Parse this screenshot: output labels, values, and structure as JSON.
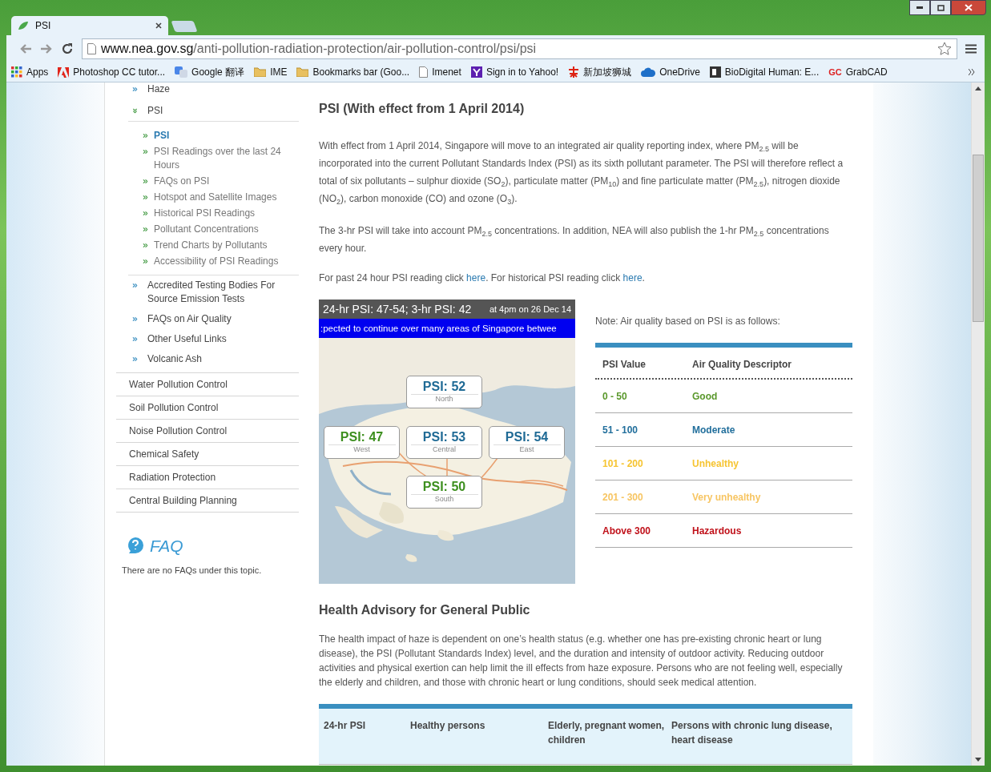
{
  "tabs": [
    {
      "label": "PSI",
      "selected": true
    }
  ],
  "address": {
    "host": "www.nea.gov.sg",
    "path": "/anti-pollution-radiation-protection/air-pollution-control/psi/psi"
  },
  "bookmarks": [
    {
      "label": "Apps",
      "kind": "apps"
    },
    {
      "label": "Photoshop CC tutor...",
      "kind": "adobe"
    },
    {
      "label": "Google 翻译",
      "kind": "translate"
    },
    {
      "label": "IME",
      "kind": "folder"
    },
    {
      "label": "Bookmarks bar (Goo...",
      "kind": "folder"
    },
    {
      "label": "Imenet",
      "kind": "page"
    },
    {
      "label": "Sign in to Yahoo!",
      "kind": "yahoo"
    },
    {
      "label": "新加坡狮城",
      "kind": "emblem"
    },
    {
      "label": "OneDrive",
      "kind": "cloud"
    },
    {
      "label": "BioDigital Human: E...",
      "kind": "square"
    },
    {
      "label": "GrabCAD",
      "kind": "mark",
      "mark": "GC"
    }
  ],
  "sidebar": {
    "subitems": [
      {
        "label": "Haze",
        "expanded": false
      },
      {
        "label": "PSI",
        "expanded": true,
        "children": [
          {
            "label": "PSI",
            "selected": true
          },
          {
            "label": "PSI Readings over the last 24 Hours",
            "selected": false
          },
          {
            "label": "FAQs on PSI",
            "selected": false
          },
          {
            "label": "Hotspot and Satellite Images",
            "selected": false
          },
          {
            "label": "Historical PSI Readings",
            "selected": false
          },
          {
            "label": "Pollutant Concentrations",
            "selected": false
          },
          {
            "label": "Trend Charts by Pollutants",
            "selected": false
          },
          {
            "label": "Accessibility of PSI Readings",
            "selected": false
          }
        ]
      },
      {
        "label": "Accredited Testing Bodies For Source Emission Tests",
        "expanded": false
      },
      {
        "label": "FAQs on Air Quality",
        "expanded": false
      },
      {
        "label": "Other Useful Links",
        "expanded": false
      },
      {
        "label": "Volcanic Ash",
        "expanded": false
      }
    ],
    "sections": [
      "Water Pollution Control",
      "Soil Pollution Control",
      "Noise Pollution Control",
      "Chemical Safety",
      "Radiation Protection",
      "Central Building Planning"
    ],
    "faq": {
      "title": "FAQ",
      "note": "There are no FAQs under this topic."
    }
  },
  "main": {
    "heading": "PSI (With effect from 1 April 2014)",
    "paragraphs": [
      "With effect from 1 April 2014, Singapore will move to an integrated air quality reporting index, where PM$_{2.5}$ will be incorporated into the current Pollutant Standards Index (PSI) as its sixth pollutant parameter. The PSI will therefore reflect a total of six pollutants – sulphur dioxide (SO$_{2}$), particulate matter (PM$_{10}$) and fine particulate matter (PM$_{2.5}$), nitrogen dioxide (NO$_{2}$), carbon monoxide (CO) and ozone (O$_{3}$).",
      "The 3-hr PSI will take into account PM$_{2.5}$ concentrations. In addition, NEA will also publish the 1-hr PM$_{2.5}$ concentrations every hour."
    ],
    "links_line": [
      {
        "kind": "text",
        "text": "For past 24 hour PSI reading click "
      },
      {
        "kind": "link",
        "text": "here"
      },
      {
        "kind": "text",
        "text": ". For historical PSI reading click "
      },
      {
        "kind": "link",
        "text": "here"
      },
      {
        "kind": "text",
        "text": "."
      }
    ],
    "psi_map": {
      "summary": "24-hr PSI: 47-54; 3-hr PSI: 42",
      "time": "at 4pm on 26 Dec 14",
      "ticker": ":pected to continue over many areas of Singapore betwee",
      "readings": [
        {
          "value": "PSI: 52",
          "region": "North",
          "color": "#1f6a95"
        },
        {
          "value": "PSI: 47",
          "region": "West",
          "color": "#3d8f1f"
        },
        {
          "value": "PSI: 53",
          "region": "Central",
          "color": "#1f6a95"
        },
        {
          "value": "PSI: 54",
          "region": "East",
          "color": "#1f6a95"
        },
        {
          "value": "PSI: 50",
          "region": "South",
          "color": "#3d8f1f"
        }
      ]
    },
    "note": "Note: Air quality based on PSI is as follows:",
    "quality_table": {
      "columns": [
        "PSI Value",
        "Air Quality Descriptor"
      ],
      "rows": [
        {
          "range": "0 - 50",
          "descriptor": "Good",
          "color": "#5a982c"
        },
        {
          "range": "51 - 100",
          "descriptor": "Moderate",
          "color": "#226f9c"
        },
        {
          "range": "101 - 200",
          "descriptor": "Unhealthy",
          "color": "#f6c431"
        },
        {
          "range": "201 - 300",
          "descriptor": "Very unhealthy",
          "color": "#f7c562"
        },
        {
          "range": "Above 300",
          "descriptor": "Hazardous",
          "color": "#c0111a"
        }
      ]
    },
    "health_heading": "Health Advisory for General Public",
    "health_paragraph": "The health impact of haze is dependent on one’s health status (e.g. whether one has pre-existing chronic heart or lung disease), the PSI (Pollutant Standards Index) level, and the duration and intensity of outdoor activity. Reducing outdoor activities and physical exertion can help limit the ill effects from haze exposure. Persons who are not feeling well, especially the elderly and children, and those with chronic heart or lung conditions, should seek medical attention.",
    "health_table": {
      "columns": [
        "24-hr PSI",
        "Healthy persons",
        "Elderly, pregnant women, children",
        "Persons with chronic lung disease, heart disease"
      ]
    }
  }
}
